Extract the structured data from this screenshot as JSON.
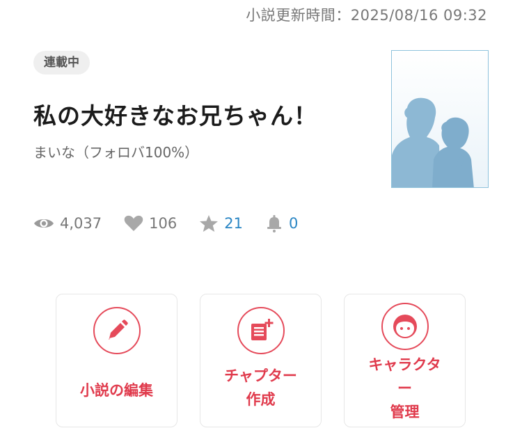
{
  "updated": {
    "text": "小説更新時間：2025/08/16 09:32"
  },
  "status_badge": "連載中",
  "novel": {
    "title": "私の大好きなお兄ちゃん！",
    "author": "まいな（フォロバ100%）"
  },
  "stats": {
    "views": "4,037",
    "likes": "106",
    "stars": "21",
    "bells": "0"
  },
  "actions": [
    {
      "label": "小説の編集",
      "icon": "pencil-icon"
    },
    {
      "label": "チャプター\n作成",
      "icon": "add-chapter-icon"
    },
    {
      "label": "キャラクタ\nー\n管理",
      "icon": "character-face-icon"
    }
  ],
  "colors": {
    "accent": "#e03a4c",
    "link": "#2a86c4",
    "cover_silhouette": "#8db8d4",
    "muted": "#777777"
  }
}
